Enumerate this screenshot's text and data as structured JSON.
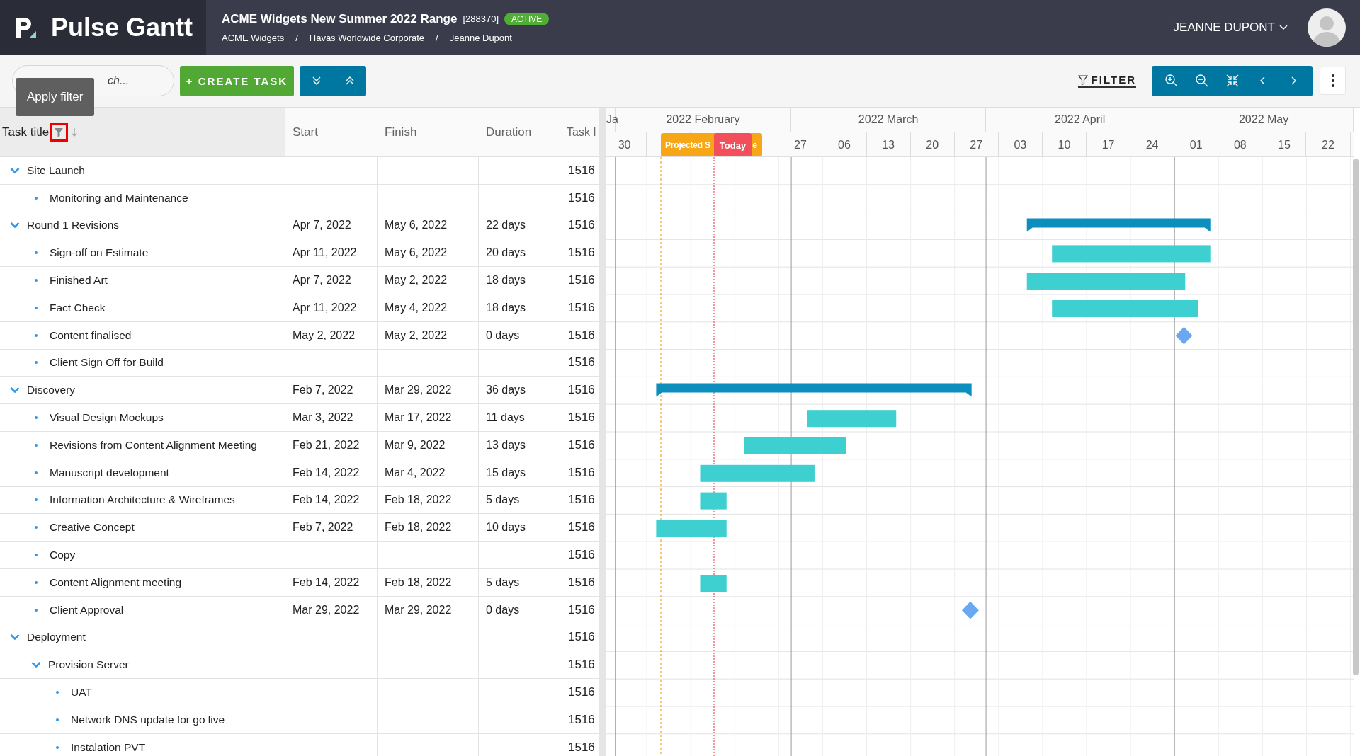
{
  "app": {
    "name": "Pulse Gantt"
  },
  "project": {
    "title": "ACME Widgets New Summer 2022 Range",
    "code": "[288370]",
    "status": "ACTIVE",
    "breadcrumbs": [
      "ACME Widgets",
      "Havas Worldwide Corporate",
      "Jeanne Dupont"
    ],
    "breadcrumb_separator": "/"
  },
  "user": {
    "name": "JEANNE DUPONT"
  },
  "toolbar": {
    "search": {
      "placeholder": "ch..."
    },
    "create_button": "+ CREATE TASK",
    "filter_button": "FILTER",
    "tooltip": "Apply filter"
  },
  "table": {
    "columns": [
      "Task title",
      "Start",
      "Finish",
      "Duration",
      "Task I"
    ],
    "rows": [
      {
        "kind": "group",
        "title": "Site Launch",
        "expanded": true,
        "task_id": "1516",
        "children": [
          {
            "kind": "task",
            "title": "Monitoring and Maintenance",
            "task_id": "1516"
          }
        ]
      },
      {
        "kind": "group",
        "title": "Round 1 Revisions",
        "expanded": true,
        "start": "Apr 7, 2022",
        "finish": "May 6, 2022",
        "duration": "22 days",
        "task_id": "1516",
        "children": [
          {
            "kind": "task",
            "title": "Sign-off on Estimate",
            "start": "Apr 11, 2022",
            "finish": "May 6, 2022",
            "duration": "20 days",
            "task_id": "1516"
          },
          {
            "kind": "task",
            "title": "Finished Art",
            "start": "Apr 7, 2022",
            "finish": "May 2, 2022",
            "duration": "18 days",
            "task_id": "1516"
          },
          {
            "kind": "task",
            "title": "Fact Check",
            "start": "Apr 11, 2022",
            "finish": "May 4, 2022",
            "duration": "18 days",
            "task_id": "1516"
          },
          {
            "kind": "task",
            "title": "Content finalised",
            "start": "May 2, 2022",
            "finish": "May 2, 2022",
            "duration": "0 days",
            "task_id": "1516"
          },
          {
            "kind": "task",
            "title": "Client Sign Off for Build",
            "task_id": "1516"
          }
        ]
      },
      {
        "kind": "group",
        "title": "Discovery",
        "expanded": true,
        "start": "Feb 7, 2022",
        "finish": "Mar 29, 2022",
        "duration": "36 days",
        "task_id": "1516",
        "children": [
          {
            "kind": "task",
            "title": "Visual Design Mockups",
            "start": "Mar 3, 2022",
            "finish": "Mar 17, 2022",
            "duration": "11 days",
            "task_id": "1516"
          },
          {
            "kind": "task",
            "title": "Revisions from Content Alignment Meeting",
            "start": "Feb 21, 2022",
            "finish": "Mar 9, 2022",
            "duration": "13 days",
            "task_id": "1516"
          },
          {
            "kind": "task",
            "title": "Manuscript development",
            "start": "Feb 14, 2022",
            "finish": "Mar 4, 2022",
            "duration": "15 days",
            "task_id": "1516"
          },
          {
            "kind": "task",
            "title": "Information Architecture & Wireframes",
            "start": "Feb 14, 2022",
            "finish": "Feb 18, 2022",
            "duration": "5 days",
            "task_id": "1516"
          },
          {
            "kind": "task",
            "title": "Creative Concept",
            "start": "Feb 7, 2022",
            "finish": "Feb 18, 2022",
            "duration": "10 days",
            "task_id": "1516"
          },
          {
            "kind": "task",
            "title": "Copy",
            "task_id": "1516"
          },
          {
            "kind": "task",
            "title": "Content Alignment meeting",
            "start": "Feb 14, 2022",
            "finish": "Feb 18, 2022",
            "duration": "5 days",
            "task_id": "1516"
          },
          {
            "kind": "task",
            "title": "Client Approval",
            "start": "Mar 29, 2022",
            "finish": "Mar 29, 2022",
            "duration": "0 days",
            "task_id": "1516"
          }
        ]
      },
      {
        "kind": "group",
        "title": "Deployment",
        "expanded": true,
        "task_id": "1516",
        "children": [
          {
            "kind": "group",
            "title": "Provision Server",
            "expanded": true,
            "task_id": "1516",
            "children": [
              {
                "kind": "task",
                "title": "UAT",
                "task_id": "1516"
              },
              {
                "kind": "task",
                "title": "Network DNS update for go live",
                "task_id": "1516"
              },
              {
                "kind": "task",
                "title": "Instalation PVT",
                "task_id": "1516"
              }
            ]
          }
        ]
      }
    ]
  },
  "timeline": {
    "months": [
      "Ja",
      "2022 February",
      "2022 March",
      "2022 April",
      "2022 May"
    ],
    "weeks": [
      "30",
      "27",
      "06",
      "13",
      "20",
      "27",
      "03",
      "10",
      "17",
      "24",
      "01",
      "08",
      "15",
      "22"
    ],
    "projected_label_parts": [
      "Projected S",
      "e"
    ],
    "today_label": "Today"
  }
}
